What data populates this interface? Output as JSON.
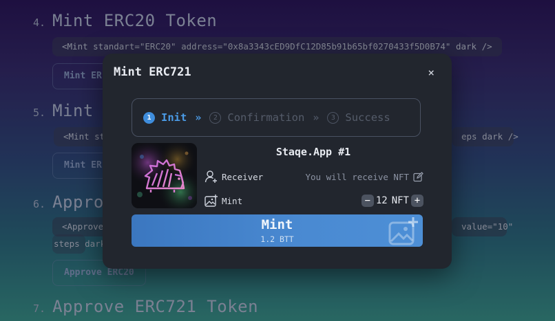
{
  "background": {
    "sections": [
      {
        "num": "4.",
        "title": "Mint ERC20 Token"
      },
      {
        "num": "5.",
        "title": "Mint"
      },
      {
        "num": "6.",
        "title": "Appro"
      },
      {
        "num": "7.",
        "title": "Approve ERC721 Token"
      }
    ],
    "code_erc20": "<Mint standart=\"ERC20\" address=\"0x8a3343cED9DfC12D85b91b65bf0270433f5D0B74\" dark />",
    "code_mint_left": "<Mint st",
    "code_mint_right": "eps dark />",
    "code_approve_left": "<Approve",
    "code_approve_right": "value=\"10\"",
    "code_approve_line2": "steps dark",
    "btn_mint_erc20": "Mint ER",
    "btn_mint": "Mint ER",
    "btn_approve": "Approve ERC20"
  },
  "modal": {
    "title": "Mint ERC721",
    "close": "×",
    "steps": [
      {
        "num": "1",
        "label": "Init",
        "active": true
      },
      {
        "num": "2",
        "label": "Confirmation",
        "active": false
      },
      {
        "num": "3",
        "label": "Success",
        "active": false
      }
    ],
    "chevron": "»",
    "nft_name": "Staqe.App #1",
    "receiver_label": "Receiver",
    "receiver_value": "You will receive NFT",
    "mint_label": "Mint",
    "quantity": "12",
    "unit": "NFT",
    "minus": "−",
    "plus": "+",
    "button_label": "Mint",
    "button_price": "1.2 BTT"
  },
  "colors": {
    "accent": "#4b9be6",
    "modal_bg": "#22262e",
    "button": "#4a8ad2"
  }
}
